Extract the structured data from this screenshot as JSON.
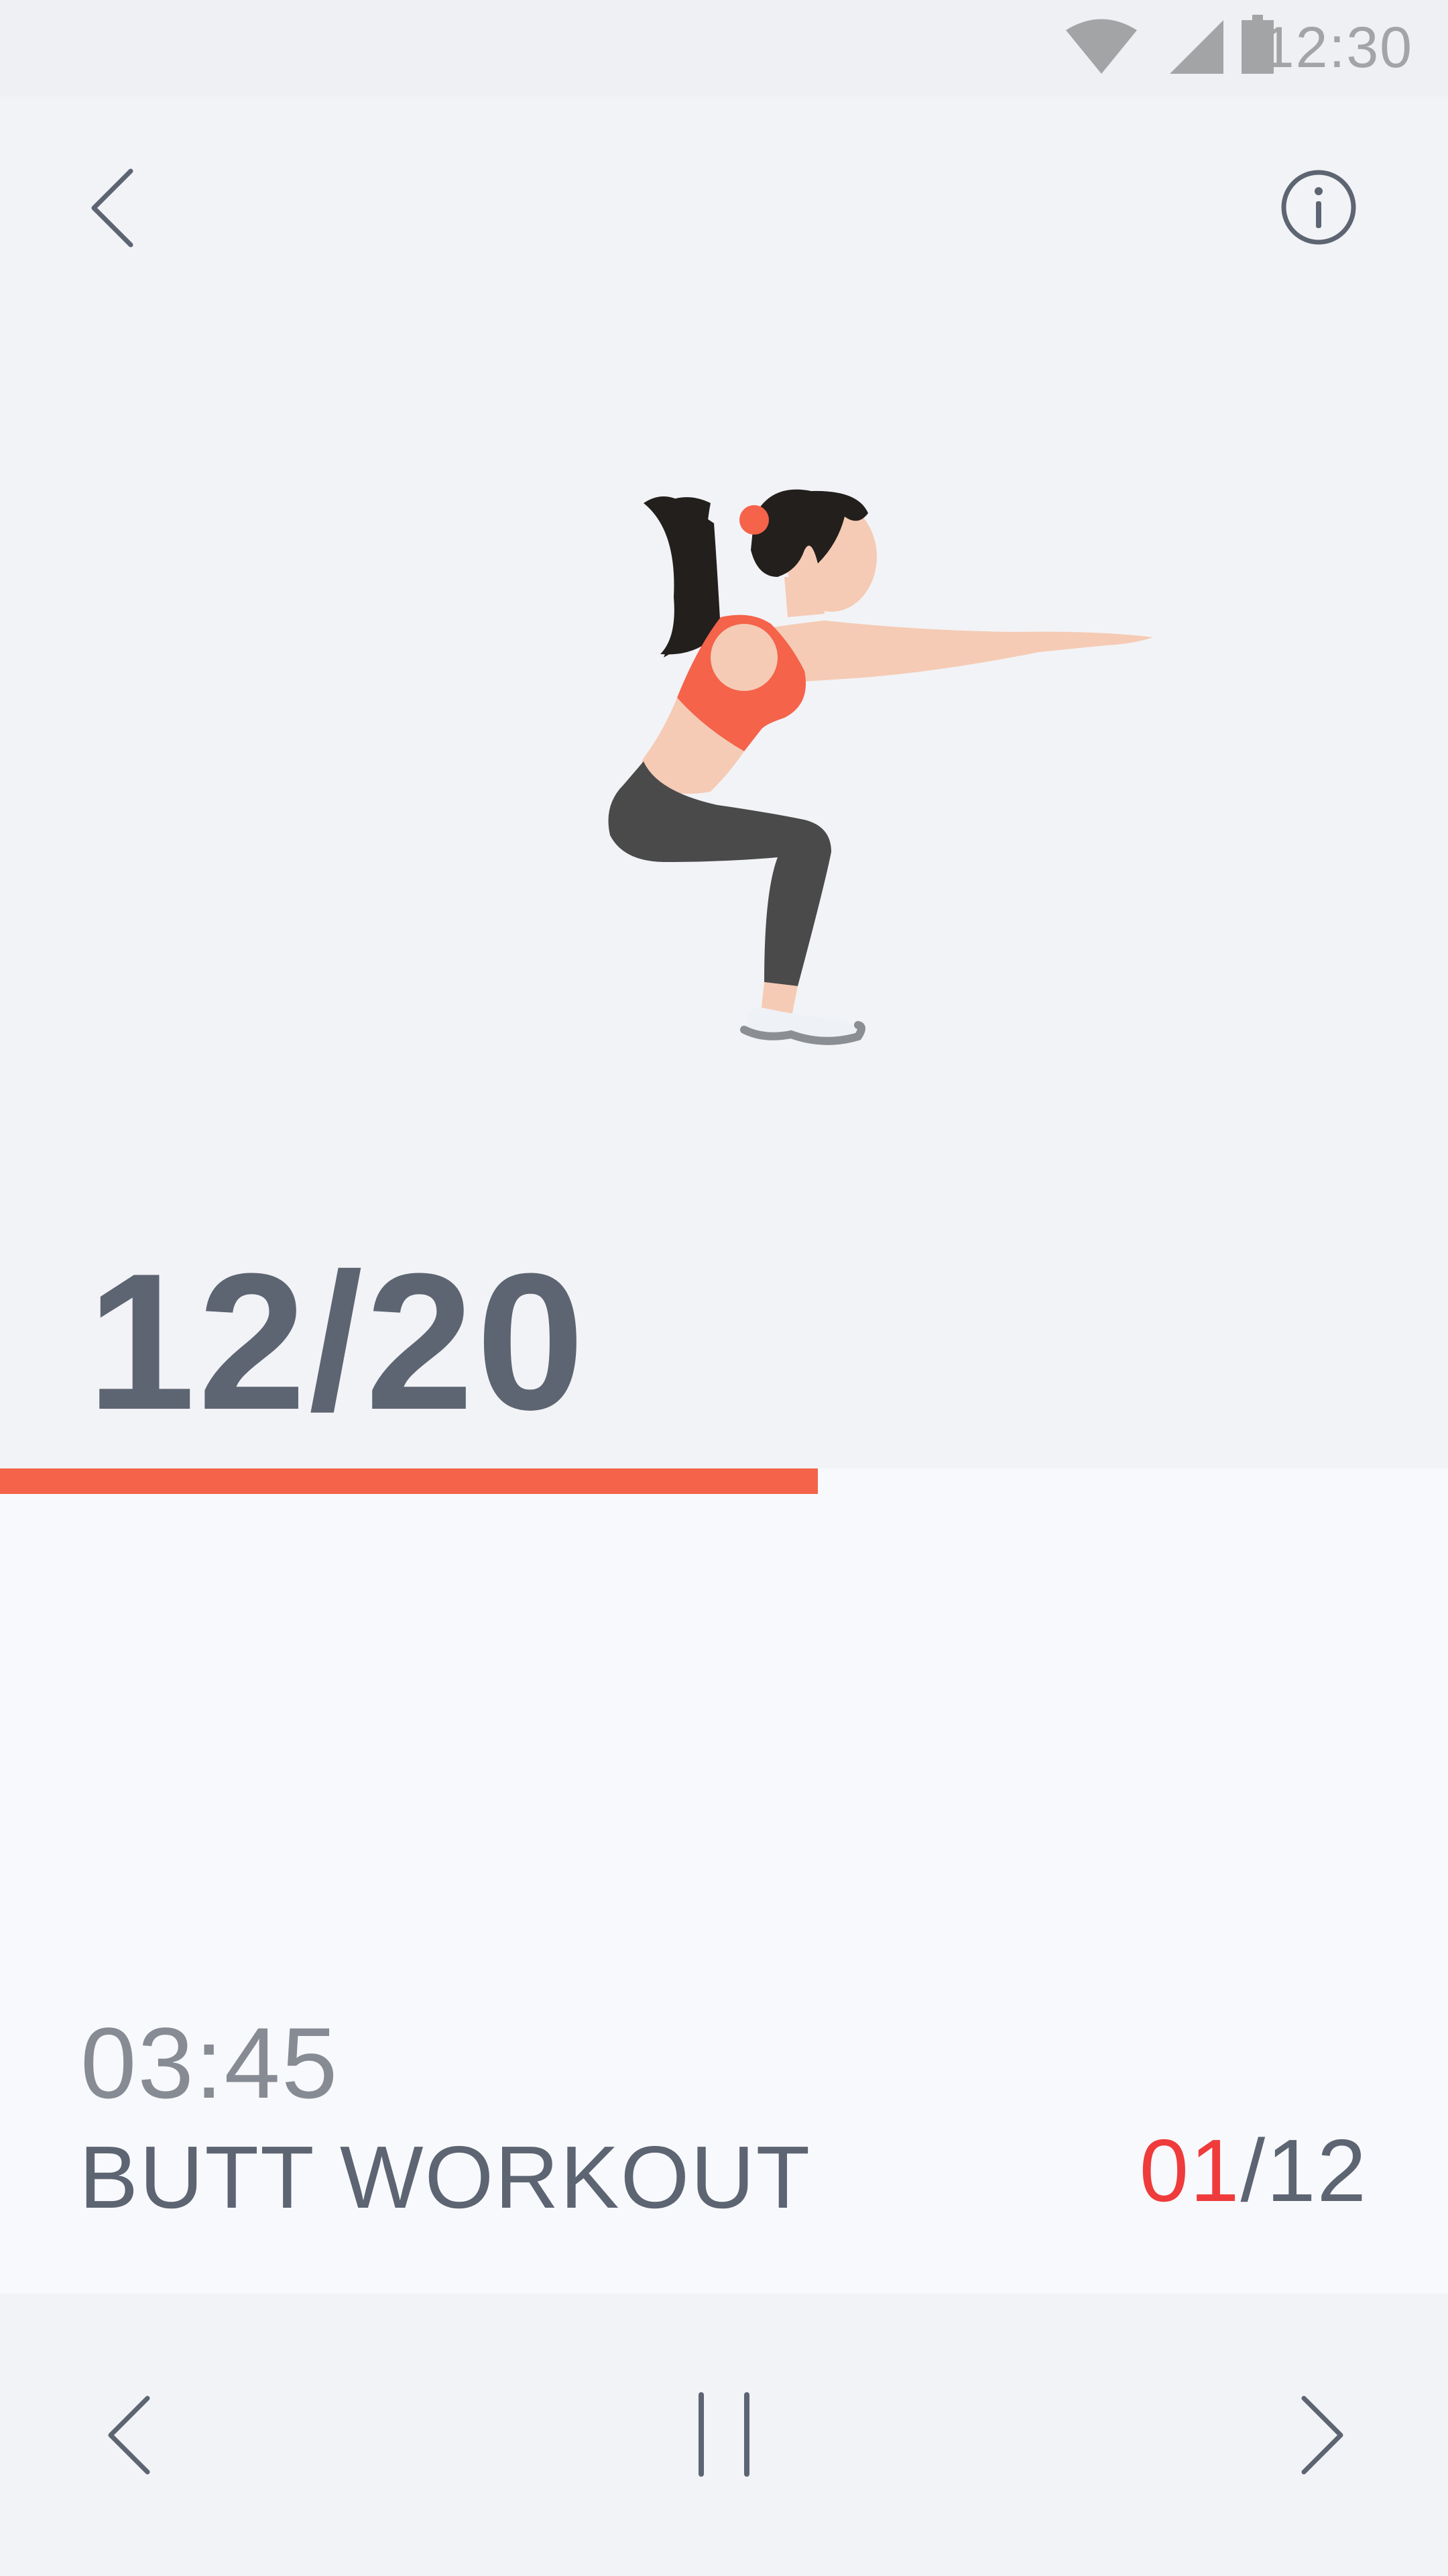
{
  "status_bar": {
    "time": "12:30",
    "icons": [
      "wifi-icon",
      "cellular-signal-icon",
      "battery-icon"
    ]
  },
  "header": {
    "back_icon": "chevron-left-icon",
    "info_icon": "info-circle-icon"
  },
  "exercise": {
    "illustration": "woman-squat-illustration",
    "reps_current": "12",
    "reps_total": "20",
    "reps_text": "12/20",
    "progress_fraction": 0.6
  },
  "session": {
    "elapsed_time": "03:45",
    "workout_name": "BUTT WORKOUT",
    "exercise_index": "01",
    "exercise_count_suffix": "/12"
  },
  "controls": {
    "previous_icon": "chevron-left-icon",
    "pause_icon": "pause-icon",
    "next_icon": "chevron-right-icon"
  },
  "colors": {
    "accent": "#f4634a",
    "current_index": "#ef3b3b",
    "text_primary": "#5d6472",
    "text_secondary": "#878b93"
  }
}
